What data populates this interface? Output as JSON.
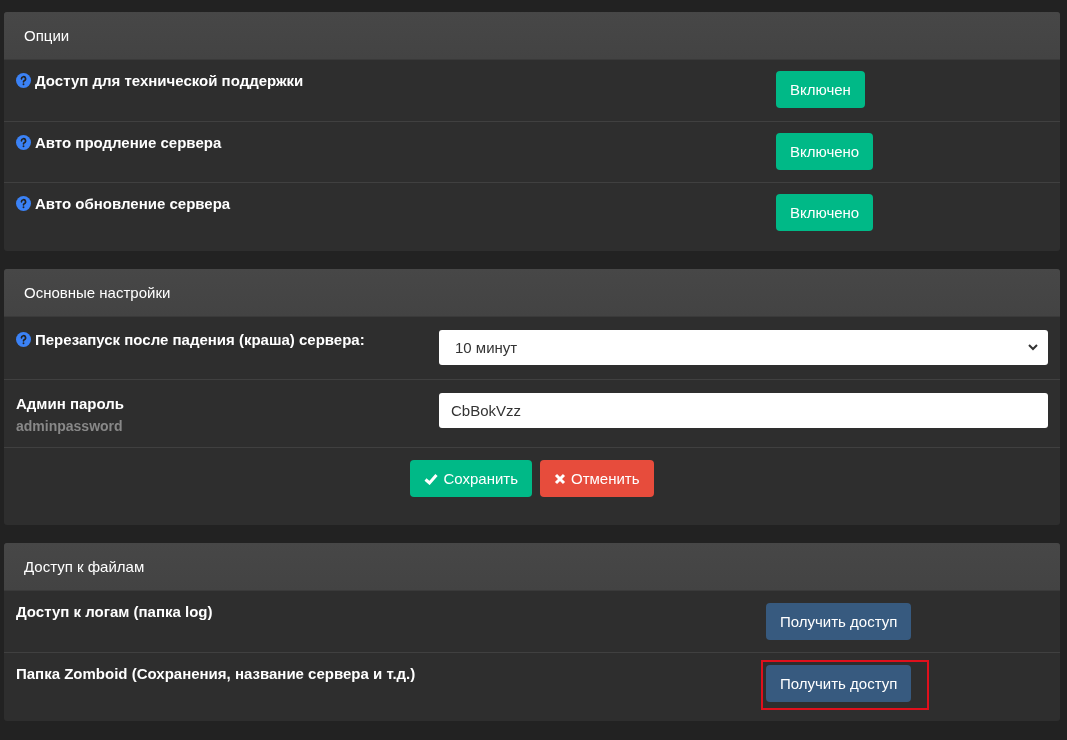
{
  "options": {
    "title": "Опции",
    "rows": [
      {
        "label": "Доступ для технической поддержки",
        "help": true,
        "button": "Включен"
      },
      {
        "label": "Авто продление сервера",
        "help": true,
        "button": "Включено"
      },
      {
        "label": "Авто обновление сервера",
        "help": true,
        "button": "Включено"
      }
    ]
  },
  "settings": {
    "title": "Основные настройки",
    "rows": [
      {
        "kind": "select",
        "label": "Перезапуск после падения (краша) сервера:",
        "help": true,
        "value": "10 минут"
      },
      {
        "kind": "text",
        "label": "Админ пароль",
        "hint": "adminpassword",
        "help": false,
        "value": "CbBokVzz"
      }
    ],
    "actions": [
      {
        "kind": "save",
        "label": "Сохранить"
      },
      {
        "kind": "cancel",
        "label": "Отменить"
      }
    ]
  },
  "files": {
    "title": "Доступ к файлам",
    "rows": [
      {
        "label": "Доступ к логам (папка log)",
        "button": "Получить доступ",
        "highlighted": false
      },
      {
        "label": "Папка Zomboid (Сохранения, название сервера и т.д.)",
        "button": "Получить доступ",
        "highlighted": true
      }
    ]
  }
}
